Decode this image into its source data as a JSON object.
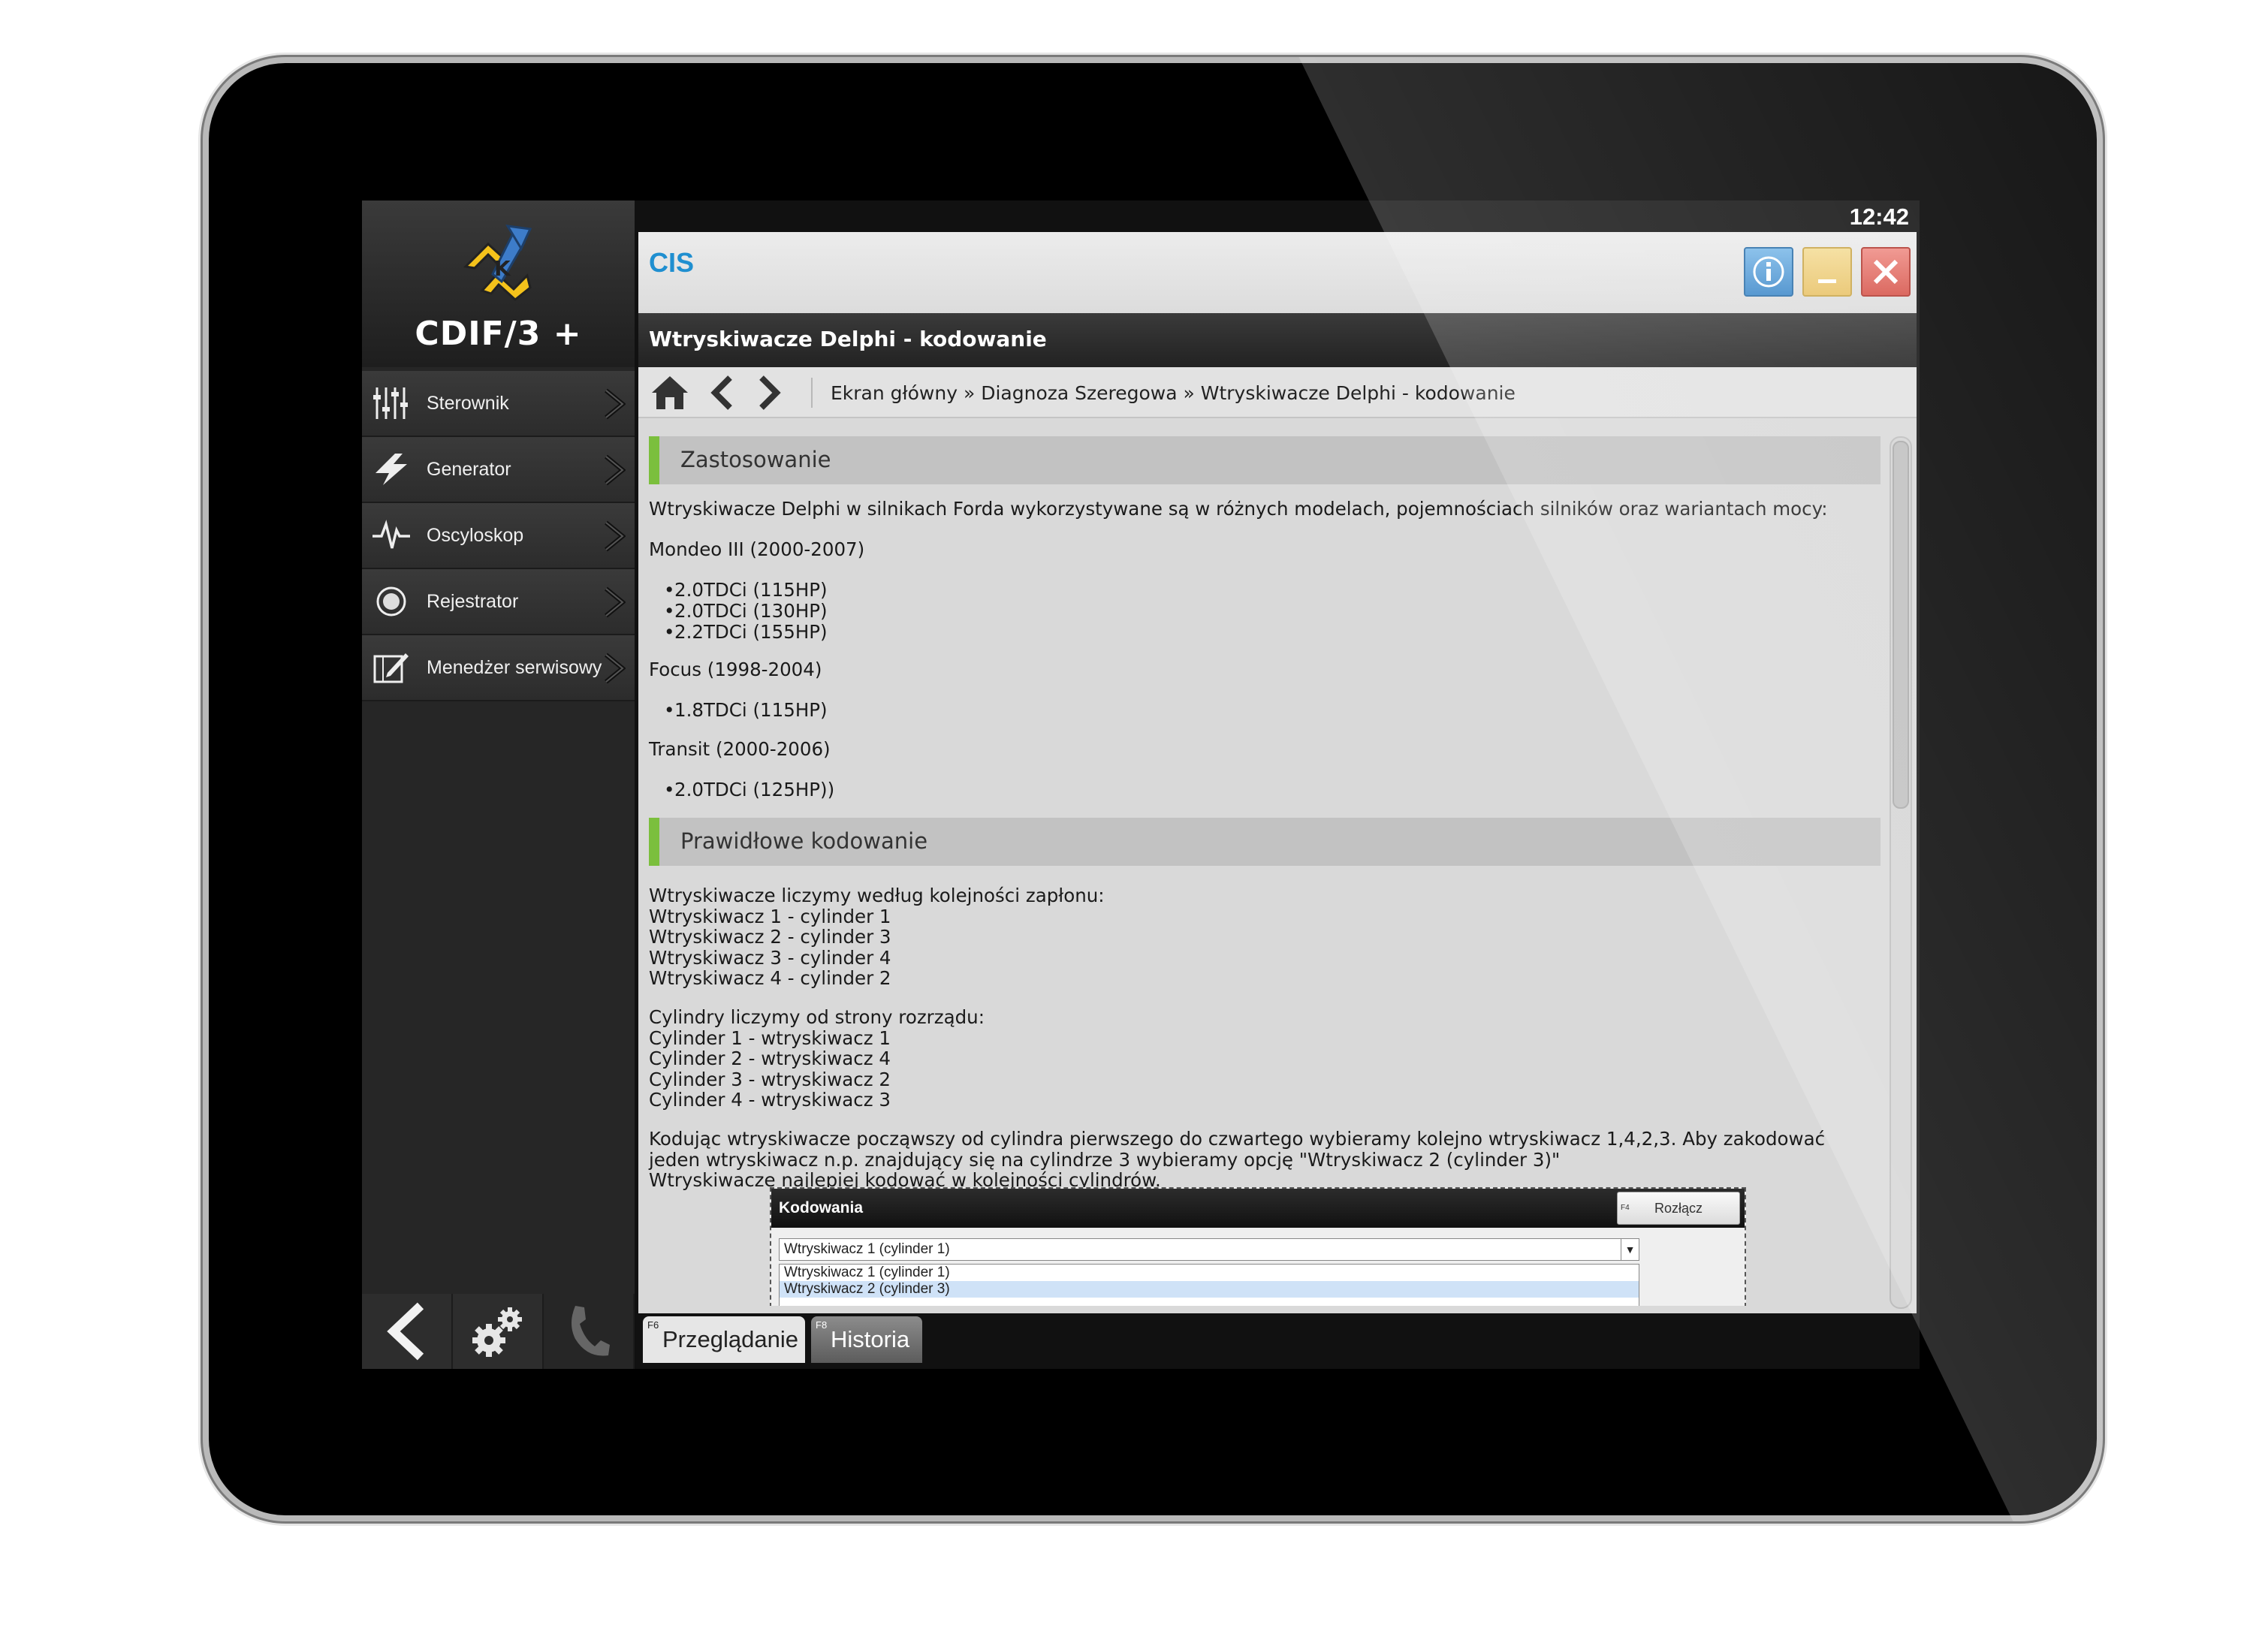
{
  "clock": "12:42",
  "logo": {
    "text": "CDIF/3",
    "mark_suffix": "+"
  },
  "sidebar": {
    "items": [
      {
        "label": "Sterownik",
        "icon": "sliders-icon"
      },
      {
        "label": "Generator",
        "icon": "lightning-icon"
      },
      {
        "label": "Oscyloskop",
        "icon": "waveform-icon"
      },
      {
        "label": "Rejestrator",
        "icon": "record-icon"
      },
      {
        "label": "Menedżer serwisowy",
        "icon": "notebook-edit-icon"
      }
    ],
    "bottom": [
      "back-arrow-icon",
      "settings-gears-icon",
      "phone-icon"
    ]
  },
  "window": {
    "app_title": "CIS",
    "page_title": "Wtryskiwacze Delphi - kodowanie",
    "buttons": {
      "info": "i",
      "minimize": "_",
      "close": "×"
    },
    "breadcrumb": "Ekran główny » Diagnoza Szeregowa » Wtryskiwacze Delphi - kodowanie"
  },
  "content": {
    "section1": {
      "title": "Zastosowanie",
      "intro": "Wtryskiwacze Delphi w silnikach Forda wykorzystywane są w różnych modelach, pojemnościach silników oraz wariantach mocy:",
      "models": [
        {
          "name": "Mondeo III (2000-2007)",
          "engines": [
            "2.0TDCi (115HP)",
            "2.0TDCi (130HP)",
            "2.2TDCi (155HP)"
          ]
        },
        {
          "name": "Focus (1998-2004)",
          "engines": [
            "1.8TDCi (115HP)"
          ]
        },
        {
          "name": "Transit (2000-2006)",
          "engines": [
            "2.0TDCi (125HP))"
          ]
        }
      ]
    },
    "section2": {
      "title": "Prawidłowe kodowanie",
      "block1": "Wtryskiwacze liczymy według kolejności zapłonu:\nWtryskiwacz 1 - cylinder 1\nWtryskiwacz 2 - cylinder 3\nWtryskiwacz 3 - cylinder 4\nWtryskiwacz 4 - cylinder 2",
      "block2": "Cylindry liczymy od strony rozrządu:\nCylinder 1 - wtryskiwacz 1\nCylinder 2 - wtryskiwacz 4\nCylinder 3 - wtryskiwacz 2\nCylinder 4 - wtryskiwacz 3",
      "block3": "Kodując wtryskiwacze począwszy od cylindra pierwszego do czwartego wybieramy kolejno wtryskiwacz 1,4,2,3. Aby zakodować\njeden wtryskiwacz n.p. znajdujący się na cylindrze 3 wybieramy opcję \"Wtryskiwacz 2 (cylinder 3)\"\nWtryskiwacze najlepiej kodować w kolejności cylindrów."
    },
    "screenshot": {
      "title": "Kodowania",
      "key": "F4",
      "button": "Rozłącz",
      "selected": "Wtryskiwacz 1 (cylinder 1)",
      "options": [
        "Wtryskiwacz 1 (cylinder 1)",
        "Wtryskiwacz 2 (cylinder 3)"
      ]
    }
  },
  "tabs": [
    {
      "key": "F6",
      "label": "Przeglądanie",
      "active": true
    },
    {
      "key": "F8",
      "label": "Historia",
      "active": false
    }
  ]
}
